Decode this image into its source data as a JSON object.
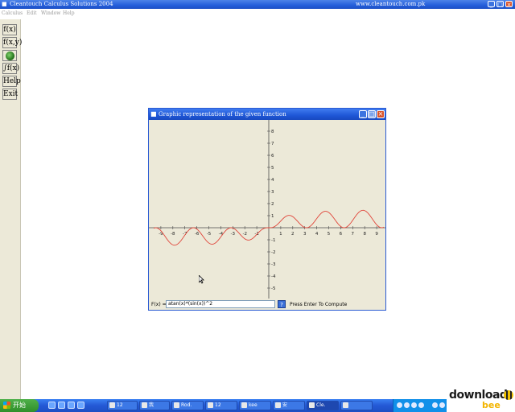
{
  "app": {
    "title": "Cleantouch Calculus Solutions 2004",
    "url": "www.cleantouch.com.pk"
  },
  "menu": [
    "Calculus",
    "Edit",
    "Window",
    "Help"
  ],
  "tools": [
    "f(x)",
    "f(x,y)",
    "",
    "∫f(x)",
    "Help",
    "Exit"
  ],
  "graph_window": {
    "title": "Graphic representation of the given function",
    "fx_label": "F(x) =",
    "fx_value": "atan(x)*(sin(x))^2",
    "help_label": "?",
    "hint": "Press Enter To Compute",
    "colors": {
      "curve": "#e0453a",
      "axis": "#4d4d4d",
      "background": "#ece9d8"
    }
  },
  "chart_data": {
    "type": "line",
    "function": "atan(x)*(sin(x))^2",
    "xlim": [
      -9.6,
      9.6
    ],
    "ylim": [
      -6,
      8
    ],
    "x_ticks": [
      -9,
      -8,
      -7,
      -6,
      -5,
      -4,
      -3,
      -2,
      -1,
      1,
      2,
      3,
      4,
      5,
      6,
      7,
      8,
      9
    ],
    "y_ticks": [
      -5,
      -4,
      -3,
      -2,
      -1,
      1,
      2,
      3,
      4,
      5,
      6,
      7,
      8
    ],
    "grid": false
  },
  "taskbar": {
    "start_label": "开始",
    "tasks": [
      "12",
      "我",
      "Rod.",
      "12",
      "kee",
      "安",
      "Cle."
    ]
  },
  "watermark": {
    "text1": "download",
    "text2": "bee"
  }
}
